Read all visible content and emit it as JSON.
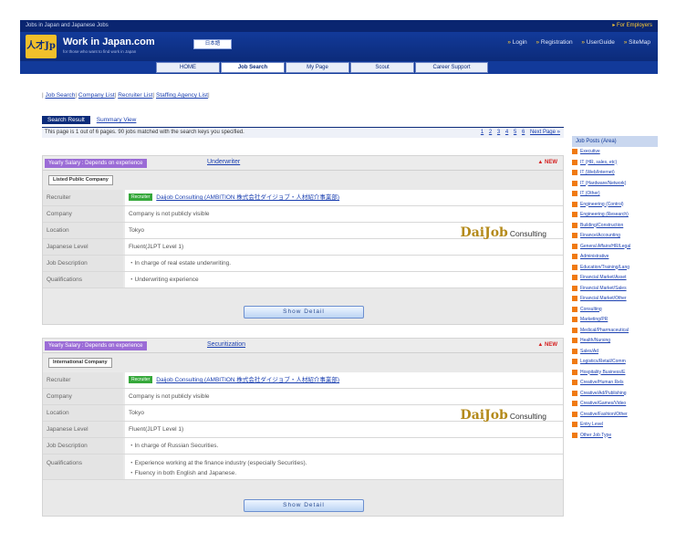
{
  "header": {
    "tagline": "Jobs in Japan and Japanese Jobs",
    "employer_link": "▸ For Employers",
    "logo_text": "人才Jp",
    "site_name": "Work in Japan.com",
    "site_sub": "for those who want to find work in Japan",
    "language_button": "日本語",
    "links": [
      "Login",
      "Registration",
      "UserGuide",
      "SiteMap"
    ]
  },
  "nav": {
    "tabs": [
      "HOME",
      "Job Search",
      "My Page",
      "Scout",
      "Career Support"
    ],
    "active": "Job Search"
  },
  "sublinks": [
    "Job Search",
    "Company List",
    "Recruiter List",
    "Staffing Agency List"
  ],
  "view_tabs": {
    "active": "Search Result",
    "other": "Summary View"
  },
  "result_summary": {
    "text": "This page is 1 out of 6 pages. 90 jobs matched with the search keys you specified.",
    "pages": [
      "1",
      "2",
      "3",
      "4",
      "5",
      "6"
    ],
    "next": "Next Page »"
  },
  "jobs": [
    {
      "salary": "Yearly Salary : Depends on experience",
      "title": "Underwriter",
      "badge": "▲ NEW",
      "company_type": "Listed Public Company",
      "recruiter_badge": "Recruiter",
      "recruiter": "Daijob Consulting (AMBITION 株式会社ダイジョブ・人材紹介事業部)",
      "company": "Company is not publicly visible",
      "location": "Tokyo",
      "japanese_level": "Fluent(JLPT Level 1)",
      "description": "・In charge of real estate underwriting.",
      "qualifications": [
        "・Underwriting experience"
      ],
      "logo": "DaiJob",
      "logo_suffix": "Consulting",
      "button": "Show Detail"
    },
    {
      "salary": "Yearly Salary : Depends on experience",
      "title": "Securitization",
      "badge": "▲ NEW",
      "company_type": "International Company",
      "recruiter_badge": "Recruiter",
      "recruiter": "Daijob Consulting (AMBITION 株式会社ダイジョブ・人材紹介事業部)",
      "company": "Company is not publicly visible",
      "location": "Tokyo",
      "japanese_level": "Fluent(JLPT Level 1)",
      "description": "・In charge of Russian Securities.",
      "qualifications": [
        "・Experience working at the finance industry (especially Securities).",
        "・Fluency in both English and Japanese."
      ],
      "logo": "DaiJob",
      "logo_suffix": "Consulting",
      "button": "Show Detail"
    }
  ],
  "labels": {
    "recruiter": "Recruiter",
    "company": "Company",
    "location": "Location",
    "japanese_level": "Japanese Level",
    "description": "Job Description",
    "qualifications": "Qualifications"
  },
  "sidebar": {
    "title": "Job Posts (Area)",
    "items": [
      "Executive",
      "IT (HR, sales, etc)",
      "IT (Web/Internet)",
      "IT (Hardware/Network)",
      "IT (Other)",
      "Engineering (Control)",
      "Engineering (Research)",
      "Building/Construction",
      "Finance/Accounting",
      "General Affairs/HR/Legal",
      "Administrative",
      "Education/Training/Lang",
      "Financial Market/Asset",
      "Financial Market/Sales",
      "Financial Market/Other",
      "Consulting",
      "Marketing/PR",
      "Medical/Pharmaceutical",
      "Health/Nursing",
      "Sales/Ad",
      "Logistics/Retail/Comm",
      "Hospitality Business/E",
      "Creative/Human Rels",
      "Creative/Ad/Publishing",
      "Creative/Games/Video",
      "Creative/Fashion/Other",
      "Entry Level",
      "Other Job Type"
    ],
    "accent_color": "#f07a12"
  }
}
